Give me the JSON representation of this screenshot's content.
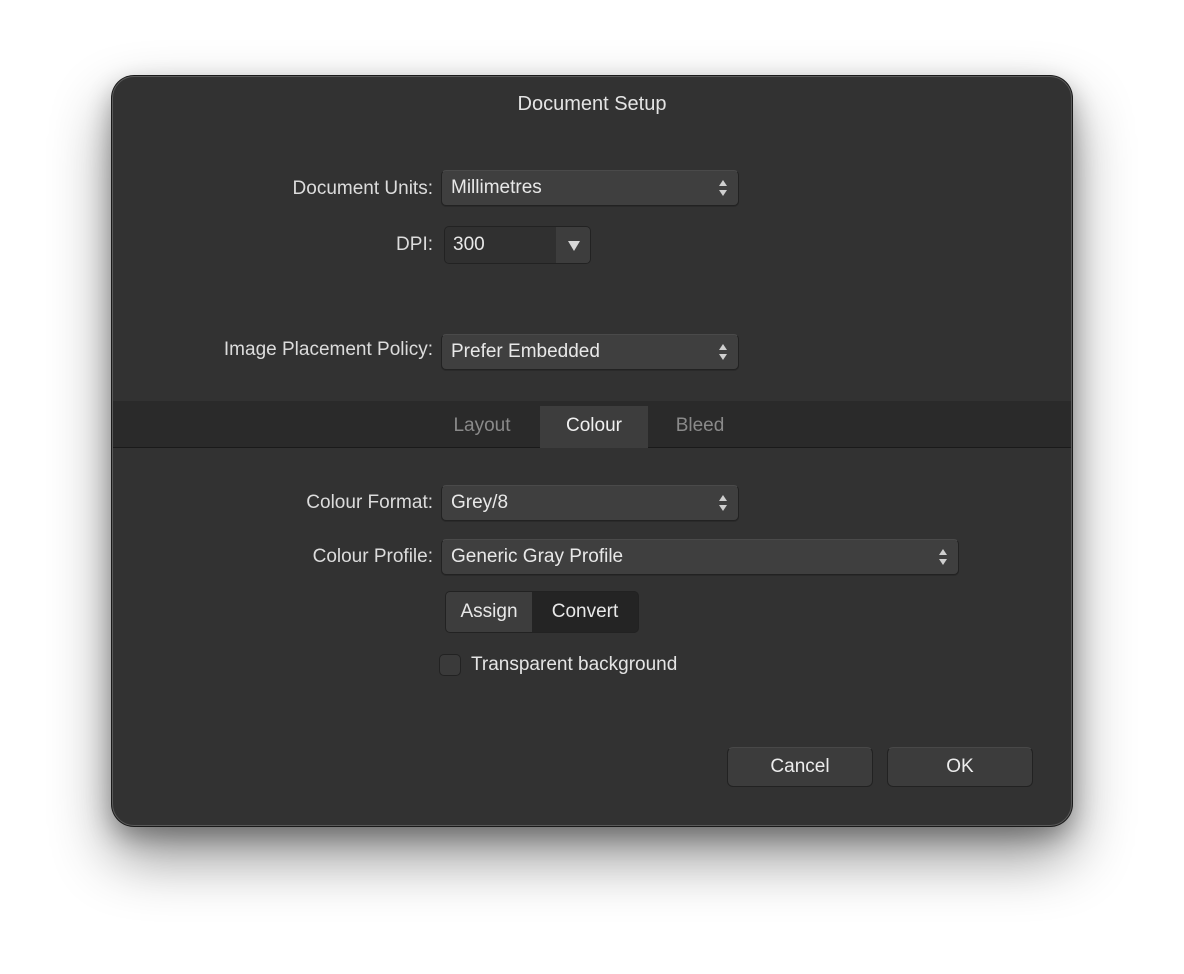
{
  "dialog": {
    "title": "Document Setup"
  },
  "fields": {
    "document_units": {
      "label": "Document Units:",
      "value": "Millimetres"
    },
    "dpi": {
      "label": "DPI:",
      "value": "300"
    },
    "image_placement": {
      "label": "Image Placement Policy:",
      "value": "Prefer Embedded"
    }
  },
  "tabs": [
    {
      "label": "Layout",
      "active": false
    },
    {
      "label": "Colour",
      "active": true
    },
    {
      "label": "Bleed",
      "active": false
    }
  ],
  "colour": {
    "format": {
      "label": "Colour Format:",
      "value": "Grey/8"
    },
    "profile": {
      "label": "Colour Profile:",
      "value": "Generic Gray Profile"
    },
    "segmented": {
      "assign": "Assign",
      "convert": "Convert"
    },
    "transparent_background": {
      "label": "Transparent background",
      "checked": false
    }
  },
  "buttons": {
    "cancel": "Cancel",
    "ok": "OK"
  }
}
